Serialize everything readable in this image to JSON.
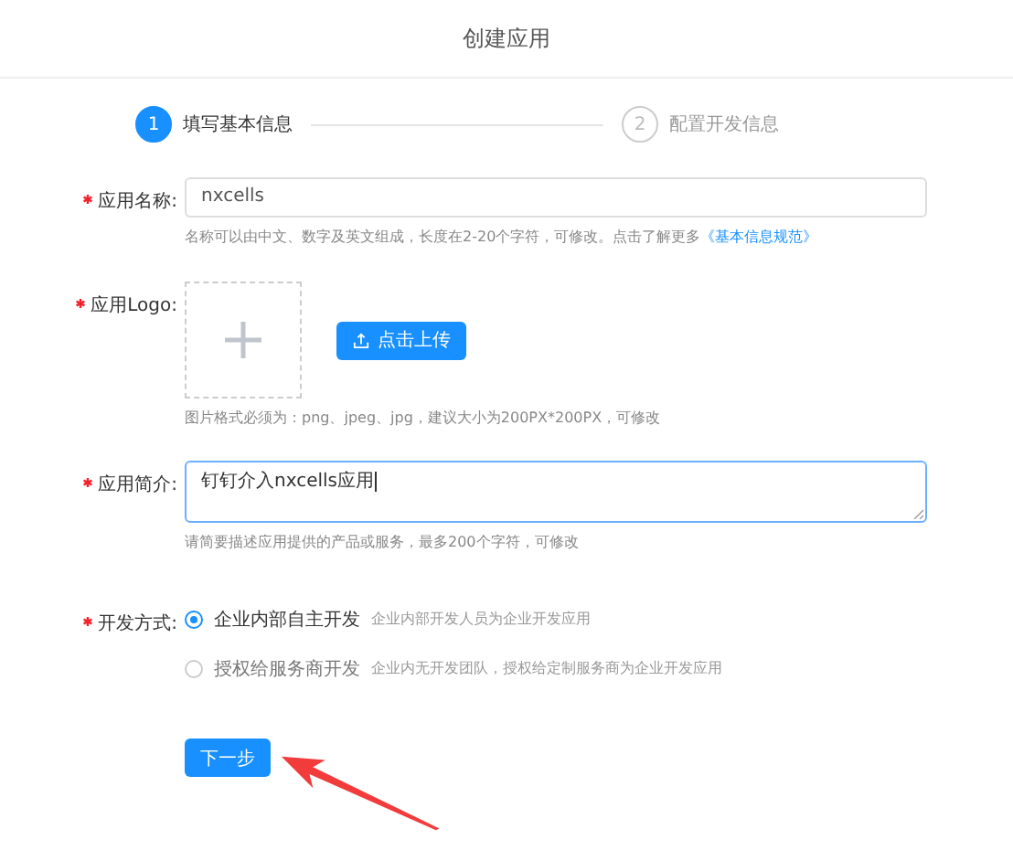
{
  "header": {
    "title": "创建应用"
  },
  "steps": [
    {
      "number": "1",
      "label": "填写基本信息",
      "selected": true
    },
    {
      "number": "2",
      "label": "配置开发信息",
      "selected": false
    }
  ],
  "fields": [
    {
      "kind": "input",
      "label": "应用名称:",
      "required": true,
      "value": "nxcells",
      "hint": "名称可以由中文、数字及英文组成，长度在2-20个字符，可修改。点击了解更多",
      "hint_link": "《基本信息规范》"
    },
    {
      "kind": "upload",
      "label": "应用Logo:",
      "required": true,
      "button": "点击上传",
      "hint": "图片格式必须为：png、jpeg、jpg，建议大小为200PX*200PX，可修改"
    },
    {
      "kind": "textarea",
      "label": "应用简介:",
      "required": true,
      "value": "钉钉介入nxcells应用",
      "focused": true,
      "hint": "请简要描述应用提供的产品或服务，最多200个字符，可修改"
    },
    {
      "kind": "radio",
      "label": "开发方式:",
      "required": true,
      "options": [
        {
          "label": "企业内部自主开发",
          "description": "企业内部开发人员为企业开发应用",
          "selected": true
        },
        {
          "label": "授权给服务商开发",
          "description": "企业内无开发团队，授权给定制服务商为企业开发应用",
          "selected": false
        }
      ]
    }
  ],
  "next_button": "下一步"
}
